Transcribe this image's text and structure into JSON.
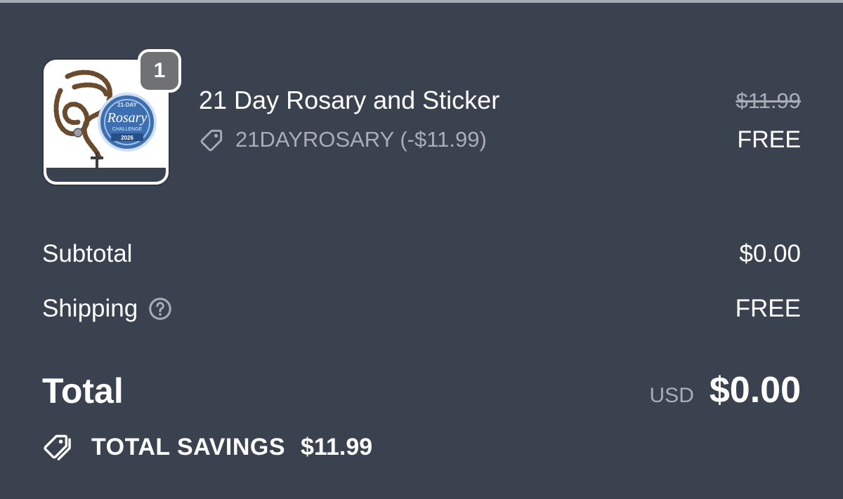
{
  "line_item": {
    "quantity": "1",
    "name": "21 Day Rosary and Sticker",
    "discount_code": "21DAYROSARY (-$11.99)",
    "original_price": "$11.99",
    "final_price": "FREE",
    "image": {
      "icon": "rosary-and-sticker-thumbnail",
      "sticker_text_top": "21-DAY",
      "sticker_text_main": "Rosary",
      "sticker_text_sub": "CHALLENGE",
      "sticker_text_year": "2026"
    }
  },
  "summary": {
    "subtotal_label": "Subtotal",
    "subtotal_value": "$0.00",
    "shipping_label": "Shipping",
    "shipping_value": "FREE",
    "total_label": "Total",
    "currency": "USD",
    "total_value": "$0.00",
    "savings_label": "TOTAL SAVINGS",
    "savings_value": "$11.99"
  },
  "colors": {
    "background": "#3a4250",
    "text_primary": "#ffffff",
    "text_muted": "#a9adb5",
    "badge": "#6f7173"
  },
  "icons": [
    "discount-tag-icon",
    "help-circle-icon",
    "savings-tags-icon"
  ]
}
